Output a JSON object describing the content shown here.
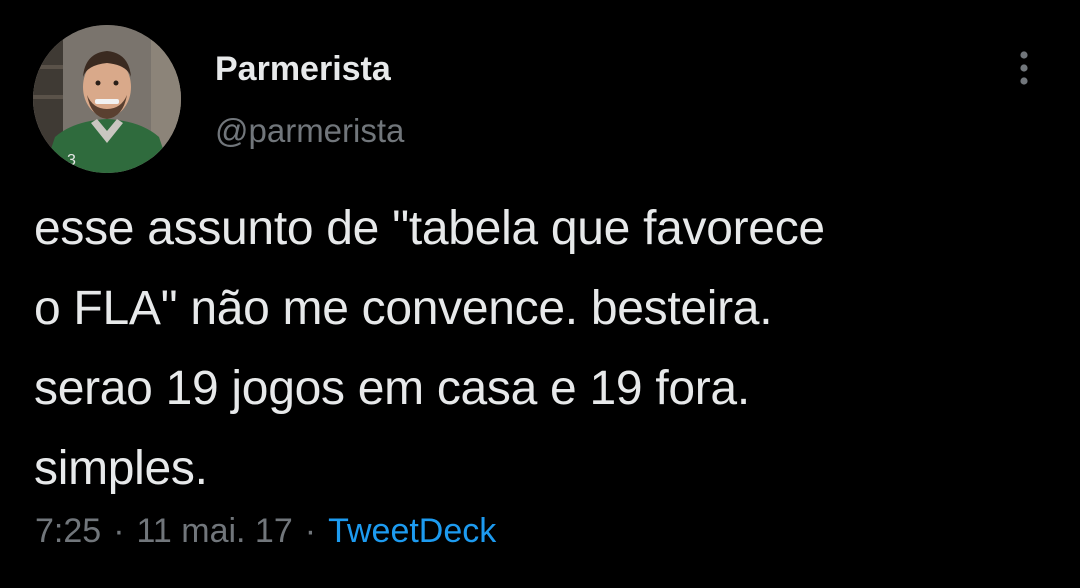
{
  "tweet": {
    "author": {
      "display_name": "Parmerista",
      "handle": "@parmerista",
      "avatar_icon": "profile-photo"
    },
    "text": "esse assunto de \"tabela que favorece\no FLA\" não me convence. besteira.\nserao 19 jogos em casa e 19 fora.\nsimples.",
    "time": "7:25",
    "date": "11 mai. 17",
    "separator": "·",
    "source": "TweetDeck",
    "more_icon": "more-vertical-icon"
  },
  "colors": {
    "background": "#000000",
    "primary_text": "#e7e9ea",
    "secondary_text": "#71767b",
    "link": "#1d9bf0"
  }
}
